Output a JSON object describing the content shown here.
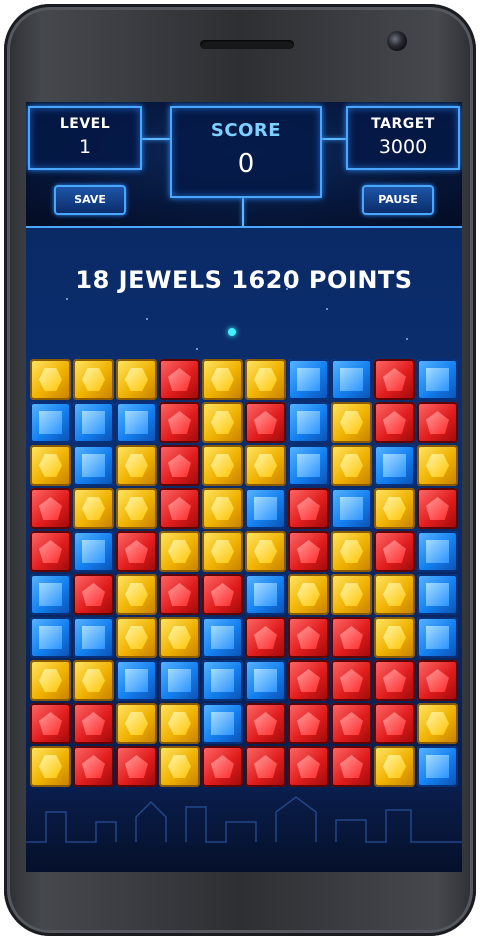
{
  "hud": {
    "level": {
      "label": "LEVEL",
      "value": "1"
    },
    "score": {
      "label": "SCORE",
      "value": "0"
    },
    "target": {
      "label": "TARGET",
      "value": "3000"
    },
    "save_label": "SAVE",
    "pause_label": "PAUSE"
  },
  "message": "18 JEWELS 1620 POINTS",
  "colors": {
    "yellow": "#f0b100",
    "blue": "#137ff0",
    "red": "#e11d1d",
    "accent": "#4aa6ff"
  },
  "board": [
    [
      "yellow",
      "yellow",
      "yellow",
      "red",
      "yellow",
      "yellow",
      "blue",
      "blue",
      "red",
      "blue"
    ],
    [
      "blue",
      "blue",
      "blue",
      "red",
      "yellow",
      "red",
      "blue",
      "yellow",
      "red",
      "red"
    ],
    [
      "yellow",
      "blue",
      "yellow",
      "red",
      "yellow",
      "yellow",
      "blue",
      "yellow",
      "blue",
      "yellow"
    ],
    [
      "red",
      "yellow",
      "yellow",
      "red",
      "yellow",
      "blue",
      "red",
      "blue",
      "yellow",
      "red"
    ],
    [
      "red",
      "blue",
      "red",
      "yellow",
      "yellow",
      "yellow",
      "red",
      "yellow",
      "red",
      "blue"
    ],
    [
      "blue",
      "red",
      "yellow",
      "red",
      "red",
      "blue",
      "yellow",
      "yellow",
      "yellow",
      "blue"
    ],
    [
      "blue",
      "blue",
      "yellow",
      "yellow",
      "blue",
      "red",
      "red",
      "red",
      "yellow",
      "blue"
    ],
    [
      "yellow",
      "yellow",
      "blue",
      "blue",
      "blue",
      "blue",
      "red",
      "red",
      "red",
      "red"
    ],
    [
      "red",
      "red",
      "yellow",
      "yellow",
      "blue",
      "red",
      "red",
      "red",
      "red",
      "yellow"
    ],
    [
      "yellow",
      "red",
      "red",
      "yellow",
      "red",
      "red",
      "red",
      "red",
      "yellow",
      "blue"
    ]
  ]
}
